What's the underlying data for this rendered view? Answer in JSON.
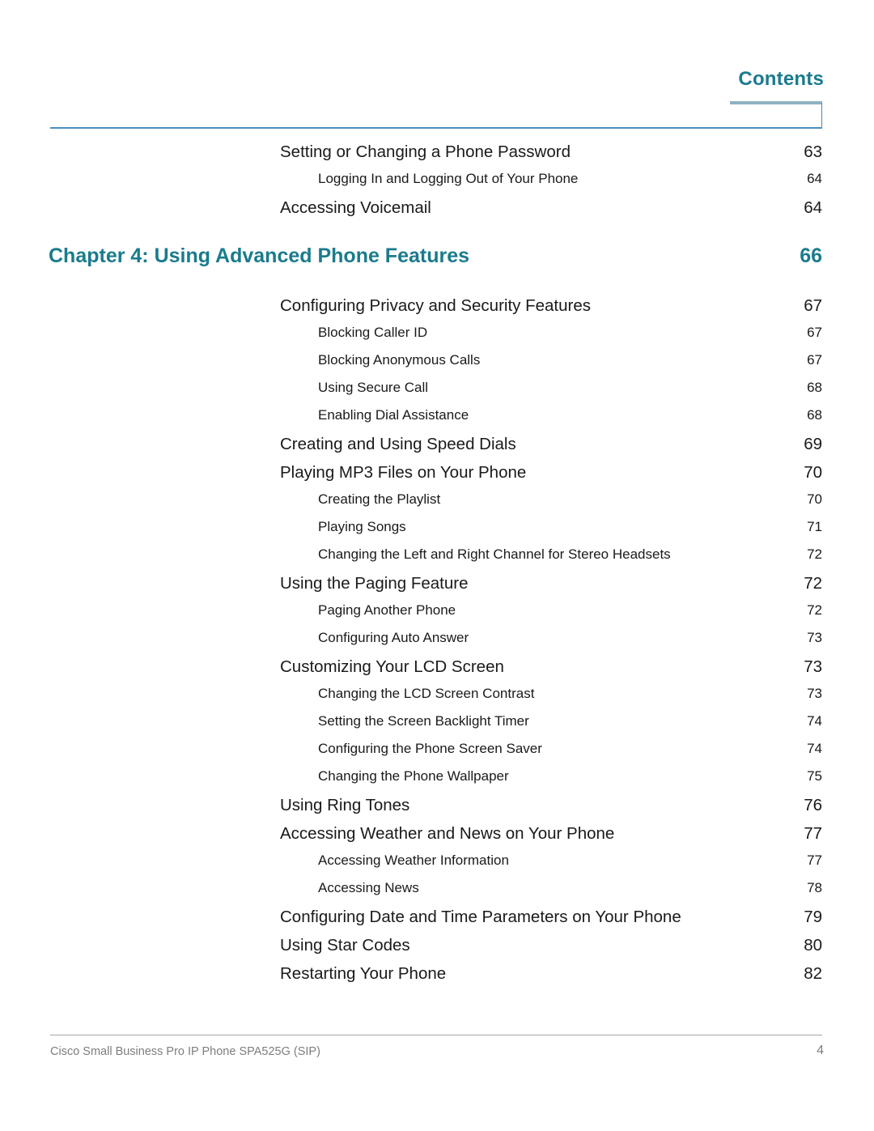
{
  "document": {
    "header_title": "Contents",
    "accent_color": "#1a7b8c",
    "rule_color": "#4a8fc0",
    "accent_bar_color": "#8fb3c0"
  },
  "toc": {
    "entries": [
      {
        "level": 1,
        "label": "Setting or Changing a Phone Password",
        "page": "63"
      },
      {
        "level": 2,
        "label": "Logging In and Logging Out of Your Phone",
        "page": "64"
      },
      {
        "level": 1,
        "label": "Accessing Voicemail",
        "page": "64"
      },
      {
        "level": 0,
        "label": "Chapter 4: Using Advanced Phone Features",
        "page": "66"
      },
      {
        "level": 1,
        "label": "Configuring Privacy and Security Features",
        "page": "67"
      },
      {
        "level": 2,
        "label": "Blocking Caller ID",
        "page": "67"
      },
      {
        "level": 2,
        "label": "Blocking Anonymous Calls",
        "page": "67"
      },
      {
        "level": 2,
        "label": "Using Secure Call",
        "page": "68"
      },
      {
        "level": 2,
        "label": "Enabling Dial Assistance",
        "page": "68"
      },
      {
        "level": 1,
        "label": "Creating and Using Speed Dials",
        "page": "69"
      },
      {
        "level": 1,
        "label": "Playing MP3 Files on Your Phone",
        "page": "70"
      },
      {
        "level": 2,
        "label": "Creating the Playlist",
        "page": "70"
      },
      {
        "level": 2,
        "label": "Playing Songs",
        "page": "71"
      },
      {
        "level": 2,
        "label": "Changing the Left and Right Channel for Stereo Headsets",
        "page": "72"
      },
      {
        "level": 1,
        "label": "Using the Paging Feature",
        "page": "72"
      },
      {
        "level": 2,
        "label": "Paging Another Phone",
        "page": "72"
      },
      {
        "level": 2,
        "label": "Configuring Auto Answer",
        "page": "73"
      },
      {
        "level": 1,
        "label": "Customizing Your LCD Screen",
        "page": "73"
      },
      {
        "level": 2,
        "label": "Changing the LCD Screen Contrast",
        "page": "73"
      },
      {
        "level": 2,
        "label": "Setting the Screen Backlight Timer",
        "page": "74"
      },
      {
        "level": 2,
        "label": "Configuring the Phone Screen Saver",
        "page": "74"
      },
      {
        "level": 2,
        "label": "Changing the Phone Wallpaper",
        "page": "75"
      },
      {
        "level": 1,
        "label": "Using Ring Tones",
        "page": "76"
      },
      {
        "level": 1,
        "label": "Accessing Weather and News on Your Phone",
        "page": "77"
      },
      {
        "level": 2,
        "label": "Accessing Weather Information",
        "page": "77"
      },
      {
        "level": 2,
        "label": "Accessing News",
        "page": "78"
      },
      {
        "level": 1,
        "label": "Configuring Date and Time Parameters on Your Phone",
        "page": "79"
      },
      {
        "level": 1,
        "label": "Using Star Codes",
        "page": "80"
      },
      {
        "level": 1,
        "label": "Restarting Your Phone",
        "page": "82"
      }
    ]
  },
  "footer": {
    "product_line": "Cisco Small Business Pro IP Phone SPA525G (SIP)",
    "page_number": "4"
  }
}
